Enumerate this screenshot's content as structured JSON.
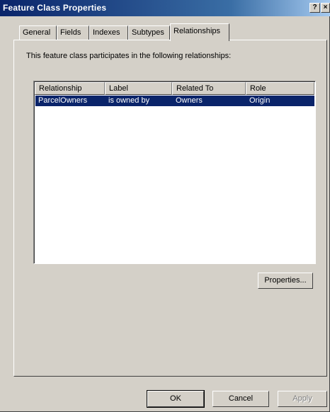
{
  "window": {
    "title": "Feature Class Properties",
    "help_label": "?",
    "close_label": "×"
  },
  "tabs": [
    {
      "label": "General",
      "active": false
    },
    {
      "label": "Fields",
      "active": false
    },
    {
      "label": "Indexes",
      "active": false
    },
    {
      "label": "Subtypes",
      "active": false
    },
    {
      "label": "Relationships",
      "active": true
    }
  ],
  "relationships_tab": {
    "intro": "This feature class participates in the following relationships:",
    "columns": [
      "Relationship",
      "Label",
      "Related To",
      "Role"
    ],
    "rows": [
      {
        "relationship": "ParcelOwners",
        "label": "is owned by",
        "related_to": "Owners",
        "role": "Origin",
        "selected": true
      }
    ],
    "properties_label": "Properties..."
  },
  "footer": {
    "ok_label": "OK",
    "cancel_label": "Cancel",
    "apply_label": "Apply"
  },
  "colors": {
    "title_gradient_start": "#0a246a",
    "selection": "#0a246a",
    "face": "#d4d0c8"
  }
}
